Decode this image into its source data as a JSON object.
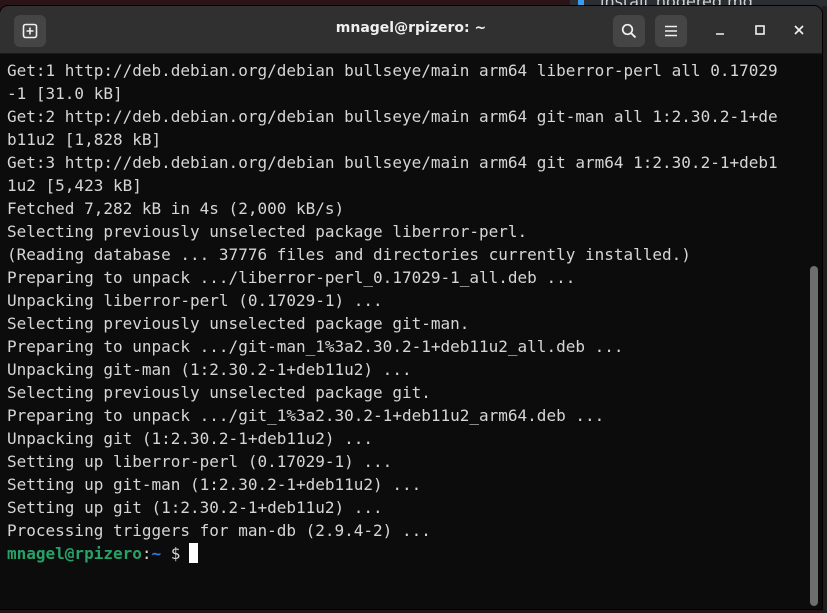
{
  "background": {
    "peek_text": "install_nodered.md"
  },
  "window": {
    "title": "mnagel@rpizero: ~",
    "new_tab_icon": "new-tab-icon",
    "search_icon": "search-icon",
    "menu_icon": "hamburger-menu-icon",
    "minimize_icon": "minimize-icon",
    "maximize_icon": "maximize-icon",
    "close_icon": "close-icon"
  },
  "terminal": {
    "lines": [
      "Get:1 http://deb.debian.org/debian bullseye/main arm64 liberror-perl all 0.17029",
      "-1 [31.0 kB]",
      "Get:2 http://deb.debian.org/debian bullseye/main arm64 git-man all 1:2.30.2-1+de",
      "b11u2 [1,828 kB]",
      "Get:3 http://deb.debian.org/debian bullseye/main arm64 git arm64 1:2.30.2-1+deb1",
      "1u2 [5,423 kB]",
      "Fetched 7,282 kB in 4s (2,000 kB/s)",
      "Selecting previously unselected package liberror-perl.",
      "(Reading database ... 37776 files and directories currently installed.)",
      "Preparing to unpack .../liberror-perl_0.17029-1_all.deb ...",
      "Unpacking liberror-perl (0.17029-1) ...",
      "Selecting previously unselected package git-man.",
      "Preparing to unpack .../git-man_1%3a2.30.2-1+deb11u2_all.deb ...",
      "Unpacking git-man (1:2.30.2-1+deb11u2) ...",
      "Selecting previously unselected package git.",
      "Preparing to unpack .../git_1%3a2.30.2-1+deb11u2_arm64.deb ...",
      "Unpacking git (1:2.30.2-1+deb11u2) ...",
      "Setting up liberror-perl (0.17029-1) ...",
      "Setting up git-man (1:2.30.2-1+deb11u2) ...",
      "Setting up git (1:2.30.2-1+deb11u2) ...",
      "Processing triggers for man-db (2.9.4-2) ..."
    ],
    "prompt": {
      "user_host": "mnagel@rpizero",
      "separator": ":",
      "path": "~",
      "symbol": " $"
    }
  },
  "colors": {
    "terminal_bg": "#0c0c0c",
    "text": "#d6d6d6",
    "prompt_user": "#26a269",
    "prompt_path": "#2a7bde",
    "titlebar": "#303030"
  }
}
